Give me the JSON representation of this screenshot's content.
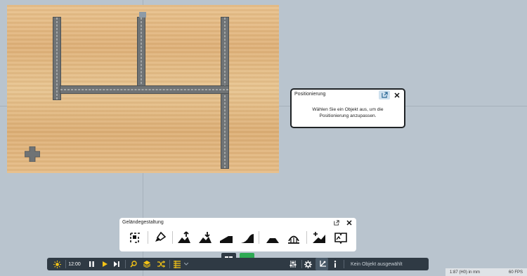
{
  "positioning_panel": {
    "title": "Positionierung",
    "message_line1": "Wählen Sie ein Objekt aus, um die",
    "message_line2": "Positionierung anzupassen."
  },
  "terrain_panel": {
    "title": "Geländegestaltung",
    "tools": [
      "select-area-icon",
      "paint-brush-icon",
      "raise-terrain-icon",
      "lower-terrain-icon",
      "ramp-icon",
      "smooth-slope-icon",
      "plateau-icon",
      "rail-terrain-icon",
      "add-terrain-icon",
      "terrain-catalog-icon"
    ]
  },
  "toolbar": {
    "time": "12:00",
    "status": "Kein Objekt ausgewählt",
    "colors": {
      "bg": "#2f3a44",
      "accent": "#f3c316",
      "active_mode": "#2eaa54"
    }
  },
  "info_bar": {
    "scale": "1:87 (H0) in mm",
    "fps": "60 FPS"
  }
}
